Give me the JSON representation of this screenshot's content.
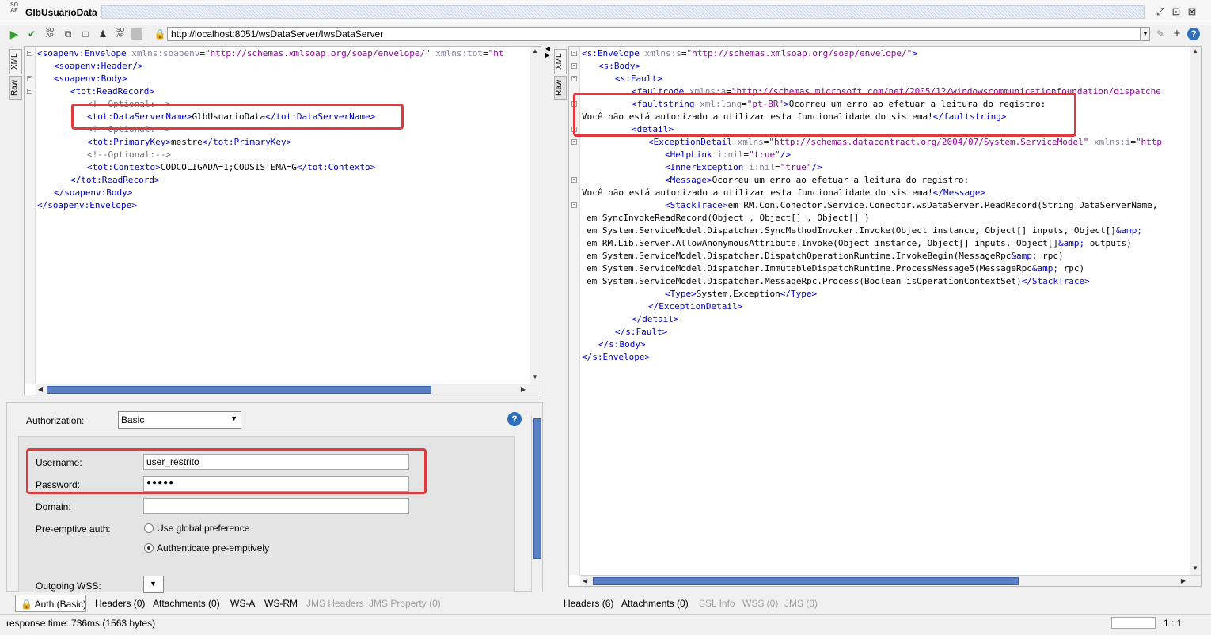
{
  "window": {
    "title": "GlbUsuarioData",
    "soap_logo": [
      "SO",
      "AP"
    ]
  },
  "toolbar": {
    "url": "http://localhost:8051/wsDataServer/IwsDataServer"
  },
  "request": {
    "tabs": [
      "XML",
      "Raw"
    ],
    "lines": [
      {
        "i": 0,
        "p": [
          [
            "tg",
            "<soapenv:Envelope "
          ],
          [
            "at",
            "xmlns:soapenv"
          ],
          [
            "tx",
            "="
          ],
          [
            "av",
            "\"http://schemas.xmlsoap.org/soap/envelope/\""
          ],
          [
            "tx",
            " "
          ],
          [
            "at",
            "xmlns:tot"
          ],
          [
            "tx",
            "="
          ],
          [
            "av",
            "\"ht"
          ]
        ]
      },
      {
        "i": 1,
        "p": [
          [
            "tg",
            "<soapenv:Header/>"
          ]
        ]
      },
      {
        "i": 1,
        "p": [
          [
            "tg",
            "<soapenv:Body>"
          ]
        ]
      },
      {
        "i": 2,
        "p": [
          [
            "tg",
            "<tot:ReadRecord>"
          ]
        ]
      },
      {
        "i": 3,
        "p": [
          [
            "cm",
            "<!--Optional:-->"
          ]
        ]
      },
      {
        "i": 3,
        "p": [
          [
            "tg",
            "<tot:DataServerName>"
          ],
          [
            "tx",
            "GlbUsuarioData"
          ],
          [
            "tg",
            "</tot:DataServerName>"
          ]
        ]
      },
      {
        "i": 3,
        "p": [
          [
            "cm",
            "<!--Optional:-->"
          ]
        ]
      },
      {
        "i": 3,
        "p": [
          [
            "tg",
            "<tot:PrimaryKey>"
          ],
          [
            "tx",
            "mestre"
          ],
          [
            "tg",
            "</tot:PrimaryKey>"
          ]
        ]
      },
      {
        "i": 3,
        "p": [
          [
            "cm",
            "<!--Optional:-->"
          ]
        ]
      },
      {
        "i": 3,
        "p": [
          [
            "tg",
            "<tot:Contexto>"
          ],
          [
            "tx",
            "CODCOLIGADA=1;CODSISTEMA=G"
          ],
          [
            "tg",
            "</tot:Contexto>"
          ]
        ]
      },
      {
        "i": 2,
        "p": [
          [
            "tg",
            "</tot:ReadRecord>"
          ]
        ]
      },
      {
        "i": 1,
        "p": [
          [
            "tg",
            "</soapenv:Body>"
          ]
        ]
      },
      {
        "i": 0,
        "p": [
          [
            "tg",
            "</soapenv:Envelope>"
          ]
        ]
      }
    ]
  },
  "response": {
    "tabs": [
      "XML",
      "Raw"
    ],
    "lines": [
      {
        "i": 0,
        "p": [
          [
            "tg",
            "<s:Envelope "
          ],
          [
            "at",
            "xmlns:s"
          ],
          [
            "tx",
            "="
          ],
          [
            "av",
            "\"http://schemas.xmlsoap.org/soap/envelope/\""
          ],
          [
            "tg",
            ">"
          ]
        ]
      },
      {
        "i": 1,
        "p": [
          [
            "tg",
            "<s:Body>"
          ]
        ]
      },
      {
        "i": 2,
        "p": [
          [
            "tg",
            "<s:Fault>"
          ]
        ]
      },
      {
        "i": 3,
        "p": [
          [
            "tg",
            "<faultcode "
          ],
          [
            "at",
            "xmlns:a"
          ],
          [
            "tx",
            "="
          ],
          [
            "av",
            "\"http://schemas.microsoft.com/net/2005/12/windowscommunicationfoundation/dispatche"
          ]
        ]
      },
      {
        "i": 3,
        "p": [
          [
            "tg",
            "<faultstring "
          ],
          [
            "at",
            "xml:lang"
          ],
          [
            "tx",
            "="
          ],
          [
            "av",
            "\"pt-BR\""
          ],
          [
            "tg",
            ">"
          ],
          [
            "tx",
            "Ocorreu um erro ao efetuar a leitura do registro:"
          ]
        ]
      },
      {
        "i": -1,
        "p": [
          [
            "tx",
            "Você não está autorizado a utilizar esta funcionalidade do sistema!"
          ],
          [
            "tg",
            "</faultstring>"
          ]
        ]
      },
      {
        "i": 3,
        "p": [
          [
            "tg",
            "<detail>"
          ]
        ]
      },
      {
        "i": 4,
        "p": [
          [
            "tg",
            "<ExceptionDetail "
          ],
          [
            "at",
            "xmlns"
          ],
          [
            "tx",
            "="
          ],
          [
            "av",
            "\"http://schemas.datacontract.org/2004/07/System.ServiceModel\""
          ],
          [
            "tx",
            " "
          ],
          [
            "at",
            "xmlns:i"
          ],
          [
            "tx",
            "="
          ],
          [
            "av",
            "\"http"
          ]
        ]
      },
      {
        "i": 5,
        "p": [
          [
            "tg",
            "<HelpLink "
          ],
          [
            "at",
            "i:nil"
          ],
          [
            "tx",
            "="
          ],
          [
            "av",
            "\"true\""
          ],
          [
            "tg",
            "/>"
          ]
        ]
      },
      {
        "i": 5,
        "p": [
          [
            "tg",
            "<InnerException "
          ],
          [
            "at",
            "i:nil"
          ],
          [
            "tx",
            "="
          ],
          [
            "av",
            "\"true\""
          ],
          [
            "tg",
            "/>"
          ]
        ]
      },
      {
        "i": 5,
        "p": [
          [
            "tg",
            "<Message>"
          ],
          [
            "tx",
            "Ocorreu um erro ao efetuar a leitura do registro:"
          ]
        ]
      },
      {
        "i": -1,
        "p": [
          [
            "tx",
            "Você não está autorizado a utilizar esta funcionalidade do sistema!"
          ],
          [
            "tg",
            "</Message>"
          ]
        ]
      },
      {
        "i": 5,
        "p": [
          [
            "tg",
            "<StackTrace>"
          ],
          [
            "tx",
            "em RM.Con.Conector.Service.Conector.wsDataServer.ReadRecord(String DataServerName, "
          ]
        ]
      },
      {
        "i": -2,
        "p": [
          [
            "tx",
            "em SyncInvokeReadRecord(Object , Object[] , Object[] )"
          ]
        ]
      },
      {
        "i": -2,
        "p": [
          [
            "tx",
            "em System.ServiceModel.Dispatcher.SyncMethodInvoker.Invoke(Object instance, Object[] inputs, Object[]"
          ],
          [
            "tg",
            "&amp;"
          ]
        ]
      },
      {
        "i": -2,
        "p": [
          [
            "tx",
            "em RM.Lib.Server.AllowAnonymousAttribute.Invoke(Object instance, Object[] inputs, Object[]"
          ],
          [
            "tg",
            "&amp;"
          ],
          [
            "tx",
            " outputs)"
          ]
        ]
      },
      {
        "i": -2,
        "p": [
          [
            "tx",
            "em System.ServiceModel.Dispatcher.DispatchOperationRuntime.InvokeBegin(MessageRpc"
          ],
          [
            "tg",
            "&amp;"
          ],
          [
            "tx",
            " rpc)"
          ]
        ]
      },
      {
        "i": -2,
        "p": [
          [
            "tx",
            "em System.ServiceModel.Dispatcher.ImmutableDispatchRuntime.ProcessMessage5(MessageRpc"
          ],
          [
            "tg",
            "&amp;"
          ],
          [
            "tx",
            " rpc)"
          ]
        ]
      },
      {
        "i": -2,
        "p": [
          [
            "tx",
            "em System.ServiceModel.Dispatcher.MessageRpc.Process(Boolean isOperationContextSet)"
          ],
          [
            "tg",
            "</StackTrace>"
          ]
        ]
      },
      {
        "i": 5,
        "p": [
          [
            "tg",
            "<Type>"
          ],
          [
            "tx",
            "System.Exception"
          ],
          [
            "tg",
            "</Type>"
          ]
        ]
      },
      {
        "i": 4,
        "p": [
          [
            "tg",
            "</ExceptionDetail>"
          ]
        ]
      },
      {
        "i": 3,
        "p": [
          [
            "tg",
            "</detail>"
          ]
        ]
      },
      {
        "i": 2,
        "p": [
          [
            "tg",
            "</s:Fault>"
          ]
        ]
      },
      {
        "i": 1,
        "p": [
          [
            "tg",
            "</s:Body>"
          ]
        ]
      },
      {
        "i": 0,
        "p": [
          [
            "tg",
            "</s:Envelope>"
          ]
        ]
      }
    ]
  },
  "auth": {
    "authorization_label": "Authorization:",
    "authorization_value": "Basic",
    "username_label": "Username:",
    "username_value": "user_restrito",
    "password_label": "Password:",
    "password_value": "●●●●●",
    "domain_label": "Domain:",
    "domain_value": "",
    "preemptive_label": "Pre-emptive auth:",
    "opt_global": "Use global preference",
    "opt_preemptive": "Authenticate pre-emptively",
    "outgoing_wss_label": "Outgoing WSS:"
  },
  "request_tabs": {
    "auth": "Auth (Basic)",
    "headers": "Headers (0)",
    "attachments": "Attachments (0)",
    "wsa": "WS-A",
    "wsrm": "WS-RM",
    "jms_headers": "JMS Headers",
    "jms_property": "JMS Property (0)"
  },
  "response_tabs": {
    "headers": "Headers (6)",
    "attachments": "Attachments (0)",
    "ssl": "SSL Info",
    "wss": "WSS (0)",
    "jms": "JMS (0)"
  },
  "status": {
    "response_time": "response time: 736ms (1563 bytes)",
    "position": "1 : 1"
  },
  "colors": {
    "highlight": "#e0393e",
    "tag": "#0000cc",
    "attr_value": "#9000a0"
  }
}
